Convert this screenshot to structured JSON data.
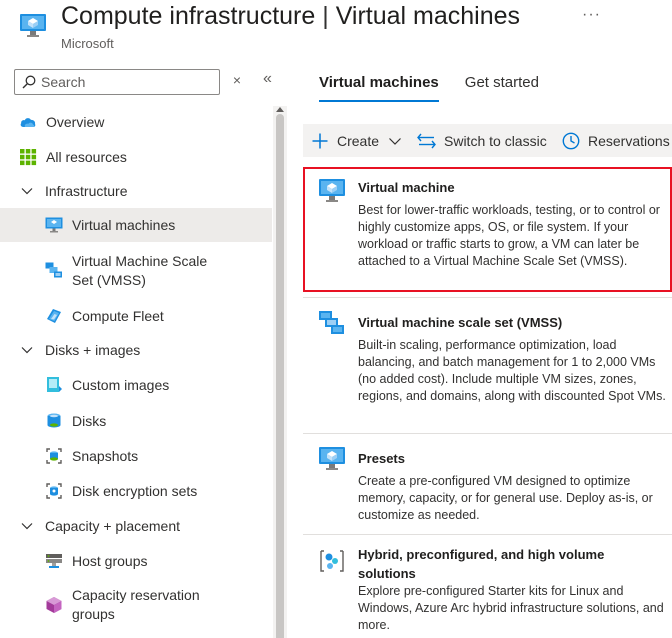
{
  "header": {
    "title_main": "Compute infrastructure",
    "title_sep": "|",
    "title_sub": "Virtual machines",
    "subtitle": "Microsoft",
    "more": "···"
  },
  "search": {
    "placeholder": "Search",
    "value": "",
    "clear": "×",
    "collapse": "«"
  },
  "sidebar": {
    "items": [
      {
        "label": "Overview"
      },
      {
        "label": "All resources"
      },
      {
        "label": "Infrastructure"
      },
      {
        "label": "Virtual machines"
      },
      {
        "label": "Virtual Machine Scale Set (VMSS)"
      },
      {
        "label": "Compute Fleet"
      },
      {
        "label": "Disks + images"
      },
      {
        "label": "Custom images"
      },
      {
        "label": "Disks"
      },
      {
        "label": "Snapshots"
      },
      {
        "label": "Disk encryption sets"
      },
      {
        "label": "Capacity + placement"
      },
      {
        "label": "Host groups"
      },
      {
        "label": "Capacity reservation groups"
      }
    ]
  },
  "tabs": [
    {
      "label": "Virtual machines"
    },
    {
      "label": "Get started"
    }
  ],
  "toolbar": {
    "create": "Create",
    "switch": "Switch to classic",
    "reservations": "Reservations"
  },
  "menu": {
    "items": [
      {
        "title": "Virtual machine",
        "desc": "Best for lower-traffic workloads, testing, or to control or highly customize apps, OS, or file system. If your workload or traffic starts to grow, a VM can later be attached to a Virtual Machine Scale Set (VMSS)."
      },
      {
        "title": "Virtual machine scale set (VMSS)",
        "desc": "Built-in scaling, performance optimization, load balancing, and batch management for 1 to 2,000 VMs (no added cost). Include multiple VM sizes, zones, regions, and domains, along with discounted Spot VMs."
      },
      {
        "title": "Presets",
        "desc": "Create a pre-configured VM designed to optimize memory, capacity, or for general use. Deploy as-is, or customize as needed."
      },
      {
        "title": "Hybrid, preconfigured, and high volume solutions",
        "desc": "Explore pre-configured Starter kits for Linux and Windows, Azure Arc hybrid infrastructure solutions, and more."
      }
    ]
  }
}
